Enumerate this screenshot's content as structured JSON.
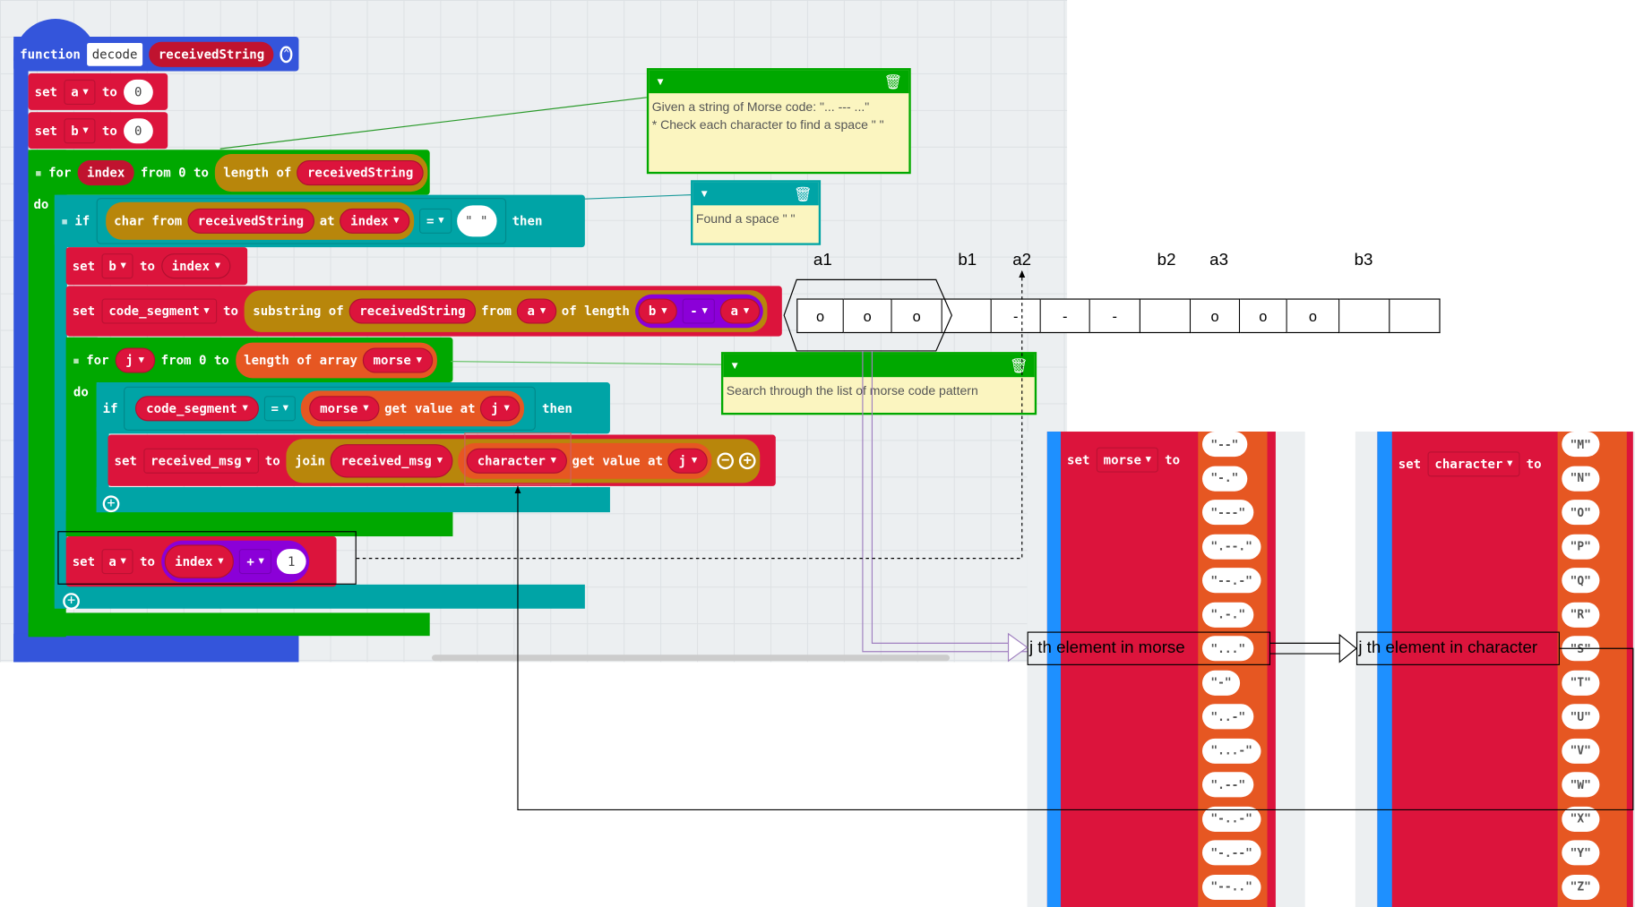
{
  "colors": {
    "function": "#3455db",
    "variable": "#dc143c",
    "loop": "#00a800",
    "logic": "#00a4a6",
    "text": "#b8860b",
    "array": "#e65722",
    "math": "#8b00d8"
  },
  "function_block": {
    "keyword": "function",
    "name": "decode",
    "param": "receivedString"
  },
  "set_a": {
    "kw": "set",
    "var": "a",
    "to": "to",
    "value": "0"
  },
  "set_b": {
    "kw": "set",
    "var": "b",
    "to": "to",
    "value": "0"
  },
  "for_index": {
    "kw": "for",
    "var": "index",
    "from": "from 0 to",
    "length": "length of",
    "arg": "receivedString",
    "do": "do"
  },
  "if_space": {
    "kw": "if",
    "char_from": "char from",
    "arg": "receivedString",
    "at": "at",
    "index": "index",
    "op": "=",
    "str": "\" \"",
    "then": "then"
  },
  "set_b_index": {
    "kw": "set",
    "var": "b",
    "to": "to",
    "value": "index"
  },
  "set_code": {
    "kw": "set",
    "var": "code_segment",
    "to": "to",
    "substring": "substring of",
    "arg": "receivedString",
    "from": "from",
    "a": "a",
    "of_length": "of length",
    "b": "b",
    "op": "-",
    "a2": "a"
  },
  "for_j": {
    "kw": "for",
    "var": "j",
    "from": "from 0 to",
    "length": "length of array",
    "arr": "morse",
    "do": "do"
  },
  "if_match": {
    "kw": "if",
    "var": "code_segment",
    "op": "=",
    "arr": "morse",
    "get": "get value at",
    "j": "j",
    "then": "then"
  },
  "set_msg": {
    "kw": "set",
    "var": "received_msg",
    "to": "to",
    "join": "join",
    "arg1": "received_msg",
    "arr": "character",
    "get": "get value at",
    "j": "j"
  },
  "set_a_next": {
    "kw": "set",
    "var": "a",
    "to": "to",
    "index": "index",
    "op": "+",
    "value": "1"
  },
  "comments": [
    {
      "line1": "Given a string of Morse code: \"... --- ...\"",
      "line2": "* Check each character to find a space \" \""
    },
    {
      "line1": "Found a space \" \""
    },
    {
      "line1": "Search through the list of morse code pattern"
    }
  ],
  "diagram": {
    "labels": [
      "a1",
      "b1",
      "a2",
      "b2",
      "a3",
      "b3"
    ],
    "cells": [
      "o",
      "o",
      "o",
      "",
      "-",
      "-",
      "-",
      "",
      "o",
      "o",
      "o",
      "",
      ""
    ],
    "box_morse": "j th element in morse",
    "box_character": "j th element in character"
  },
  "morse_list": {
    "kw": "set",
    "var": "morse",
    "to": "to",
    "items": [
      "\"--\"",
      "\"-.\"",
      "\"---\"",
      "\".--.\"",
      "\"--.-\"",
      "\".-.\"",
      "\"...\"",
      "\"-\"",
      "\"..-\"",
      "\"...-\"",
      "\".--\"",
      "\"-..-\"",
      "\"-.--\"",
      "\"--..\""
    ]
  },
  "character_list": {
    "kw": "set",
    "var": "character",
    "to": "to",
    "items": [
      "\"M\"",
      "\"N\"",
      "\"O\"",
      "\"P\"",
      "\"Q\"",
      "\"R\"",
      "\"S\"",
      "\"T\"",
      "\"U\"",
      "\"V\"",
      "\"W\"",
      "\"X\"",
      "\"Y\"",
      "\"Z\""
    ]
  }
}
